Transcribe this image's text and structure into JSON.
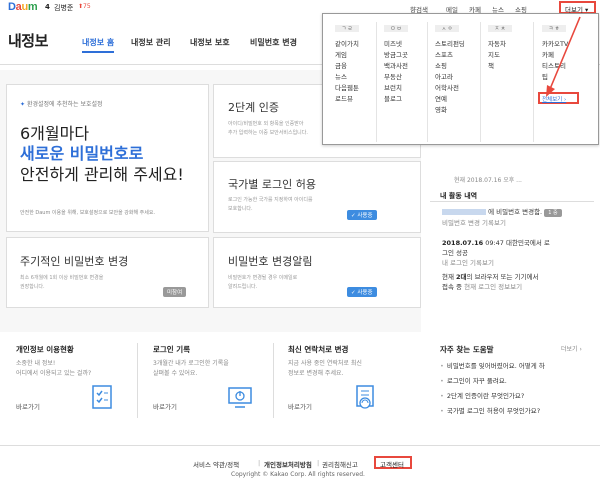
{
  "topbar": {
    "logo": [
      "D",
      "a",
      "u",
      "m"
    ],
    "user_level": "4",
    "user_name": "김병준",
    "user_score": "⬆75",
    "links": [
      "향검색",
      "메일",
      "카페",
      "뉴스",
      "쇼핑"
    ],
    "more_label": "더보기 ▾"
  },
  "header": {
    "title": "내정보",
    "tabs": [
      "내정보 홈",
      "내정보 관리",
      "내정보 보호",
      "비밀번호 변경"
    ]
  },
  "main": {
    "big_card": {
      "badge": "환경설정에 추천하는 보호설정",
      "line1": "6개월마다",
      "line2": "새로운 비밀번호로",
      "line3": "안전하게 관리해 주세요!",
      "desc": "안전한 Daum 이용을 위해, 보호설정으로 보안을 강화해 주세요."
    },
    "card_2fa": {
      "title": "2단계 인증",
      "desc1": "아이디/비밀번호 외 항목을 인증받아",
      "desc2": "추가 입력하는 이중 보안서비스입니다."
    },
    "card_country": {
      "title": "국가별 로그인 허용",
      "desc1": "로그인 가능한 국가를 지정하여 아이디를",
      "desc2": "보호합니다.",
      "pill": "✓ 사용중"
    },
    "card_periodic": {
      "title": "주기적인 비밀번호 변경",
      "desc1": "최소 6개월에 1회 이상 비밀번호 변경을",
      "desc2": "권장합니다.",
      "pill": "미참여"
    },
    "card_alert": {
      "title": "비밀번호 변경알림",
      "desc1": "비밀번호가 변경될 경우 이메일로",
      "desc2": "알려드립니다.",
      "pill": "✓ 사용중"
    }
  },
  "services": [
    {
      "title": "개인정보 이용현황",
      "desc1": "소중한 내 정보!",
      "desc2": "어디에서 이용되고 있는 걸까?",
      "link": "바로가기",
      "icon": "clipboard-check-icon"
    },
    {
      "title": "로그인 기록",
      "desc1": "3개월간 내가 로그인한 기록을",
      "desc2": "살펴볼 수 있어요.",
      "link": "바로가기",
      "icon": "monitor-power-icon"
    },
    {
      "title": "최신 연락처로 변경",
      "desc1": "지금 사용 중인 연락처로 최신",
      "desc2": "정보로 변경해 주세요.",
      "link": "바로가기",
      "icon": "document-refresh-icon"
    }
  ],
  "side": {
    "time": "현재 2018.07.16 오후 ...",
    "activity_title": "내 활동 내역",
    "activity": [
      {
        "text": "에 비밀번호 변경함.",
        "sub": "비밀번호 변경 기록보기",
        "badge": "1 중"
      },
      {
        "bold": "2018.07.16",
        "text": " 09:47 대한민국에서 로",
        "text2": "그인 성공",
        "sub": "내 로그인 기록보기"
      },
      {
        "text": "현재 ",
        "bold": "2대",
        "text2": "의 브라우저 또는 기기에서",
        "text3": "접속 중",
        "sub": "현재 로그인 정보보기"
      }
    ],
    "help_title": "자주 찾는 도움말",
    "help_more": "더보기 ›",
    "help": [
      "비밀번호를 잊어버렸어요. 어떻게 하",
      "로그인이 자꾸 풀려요.",
      "2단계 인증이란 무엇인가요?",
      "국가별 로그인 허용이 무엇인가요?"
    ]
  },
  "footer": {
    "links": [
      "서비스 약관/정책",
      "개인정보처리방침",
      "권리침해신고"
    ],
    "cs": "고객센터",
    "copyright": "Copyright © Kakao Corp. All rights reserved."
  },
  "dropdown": {
    "heads": [
      "ㄱ ㄹ",
      "ㅁ ㅂ",
      "ㅅ ㅇ",
      "ㅈ ㅊ",
      "ㅋ ㅎ"
    ],
    "cols": [
      [
        "같이가치",
        "게임",
        "금융",
        "뉴스",
        "다음웹툰",
        "로드뷰"
      ],
      [
        "미즈넷",
        "방금그곳",
        "백과사전",
        "부동산",
        "브런치",
        "블로그"
      ],
      [
        "스토리펀딩",
        "스포츠",
        "쇼핑",
        "아고라",
        "어학사전",
        "연예",
        "영화"
      ],
      [
        "자동차",
        "지도",
        "책"
      ],
      [
        "카카오TV",
        "카페",
        "티스토리",
        "팁"
      ]
    ],
    "more_link": "전체보기 ›"
  },
  "colors": {
    "accent": "#2e6fd8",
    "highlight": "#e8483d",
    "pill": "#3d8ce0"
  }
}
